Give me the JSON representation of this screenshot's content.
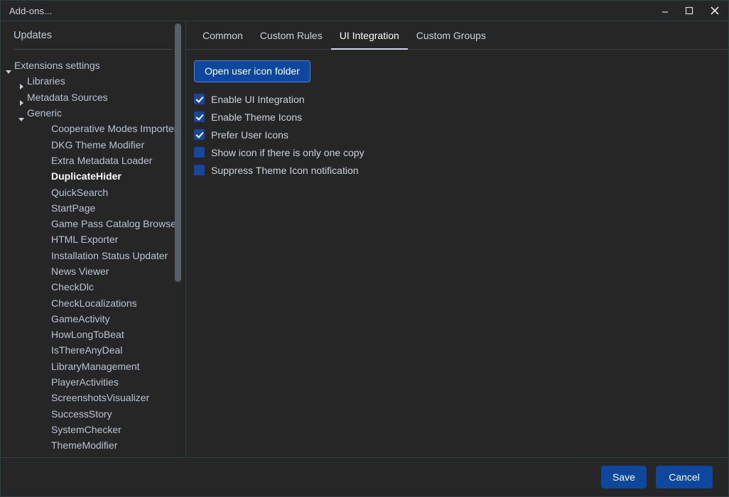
{
  "window": {
    "title": "Add-ons...",
    "controls": [
      {
        "name": "minimize",
        "glyph": "–"
      },
      {
        "name": "maximize",
        "glyph": "□"
      },
      {
        "name": "close",
        "glyph": "✕"
      }
    ]
  },
  "sidebar": {
    "updates_label": "Updates",
    "tree": [
      {
        "label": "Extensions settings",
        "level": 0,
        "arrow": "down",
        "selected": false
      },
      {
        "label": "Libraries",
        "level": 1,
        "arrow": "right",
        "selected": false
      },
      {
        "label": "Metadata Sources",
        "level": 1,
        "arrow": "right",
        "selected": false
      },
      {
        "label": "Generic",
        "level": 1,
        "arrow": "down",
        "selected": false
      },
      {
        "label": "Cooperative Modes Importer",
        "level": 2,
        "arrow": "none",
        "selected": false
      },
      {
        "label": "DKG Theme Modifier",
        "level": 2,
        "arrow": "none",
        "selected": false
      },
      {
        "label": "Extra Metadata Loader",
        "level": 2,
        "arrow": "none",
        "selected": false
      },
      {
        "label": "DuplicateHider",
        "level": 2,
        "arrow": "none",
        "selected": true
      },
      {
        "label": "QuickSearch",
        "level": 2,
        "arrow": "none",
        "selected": false
      },
      {
        "label": "StartPage",
        "level": 2,
        "arrow": "none",
        "selected": false
      },
      {
        "label": "Game Pass Catalog Browser",
        "level": 2,
        "arrow": "none",
        "selected": false
      },
      {
        "label": "HTML Exporter",
        "level": 2,
        "arrow": "none",
        "selected": false
      },
      {
        "label": "Installation Status Updater",
        "level": 2,
        "arrow": "none",
        "selected": false
      },
      {
        "label": "News Viewer",
        "level": 2,
        "arrow": "none",
        "selected": false
      },
      {
        "label": "CheckDlc",
        "level": 2,
        "arrow": "none",
        "selected": false
      },
      {
        "label": "CheckLocalizations",
        "level": 2,
        "arrow": "none",
        "selected": false
      },
      {
        "label": "GameActivity",
        "level": 2,
        "arrow": "none",
        "selected": false
      },
      {
        "label": "HowLongToBeat",
        "level": 2,
        "arrow": "none",
        "selected": false
      },
      {
        "label": "IsThereAnyDeal",
        "level": 2,
        "arrow": "none",
        "selected": false
      },
      {
        "label": "LibraryManagement",
        "level": 2,
        "arrow": "none",
        "selected": false
      },
      {
        "label": "PlayerActivities",
        "level": 2,
        "arrow": "none",
        "selected": false
      },
      {
        "label": "ScreenshotsVisualizer",
        "level": 2,
        "arrow": "none",
        "selected": false
      },
      {
        "label": "SuccessStory",
        "level": 2,
        "arrow": "none",
        "selected": false
      },
      {
        "label": "SystemChecker",
        "level": 2,
        "arrow": "none",
        "selected": false
      },
      {
        "label": "ThemeModifier",
        "level": 2,
        "arrow": "none",
        "selected": false
      }
    ]
  },
  "main": {
    "tabs": [
      {
        "label": "Common",
        "active": false
      },
      {
        "label": "Custom Rules",
        "active": false
      },
      {
        "label": "UI Integration",
        "active": true
      },
      {
        "label": "Custom Groups",
        "active": false
      }
    ],
    "open_folder_label": "Open user icon folder",
    "checkboxes": [
      {
        "label": "Enable UI Integration",
        "checked": true
      },
      {
        "label": "Enable Theme Icons",
        "checked": true
      },
      {
        "label": "Prefer User Icons",
        "checked": true
      },
      {
        "label": "Show icon if there is only one copy",
        "checked": false
      },
      {
        "label": "Suppress Theme Icon notification",
        "checked": false
      }
    ]
  },
  "footer": {
    "save_label": "Save",
    "cancel_label": "Cancel"
  },
  "colors": {
    "accent_blue": "#0d479e",
    "checkbox_blue": "#17479d",
    "window_border": "#2c4146",
    "background": "#262626"
  }
}
